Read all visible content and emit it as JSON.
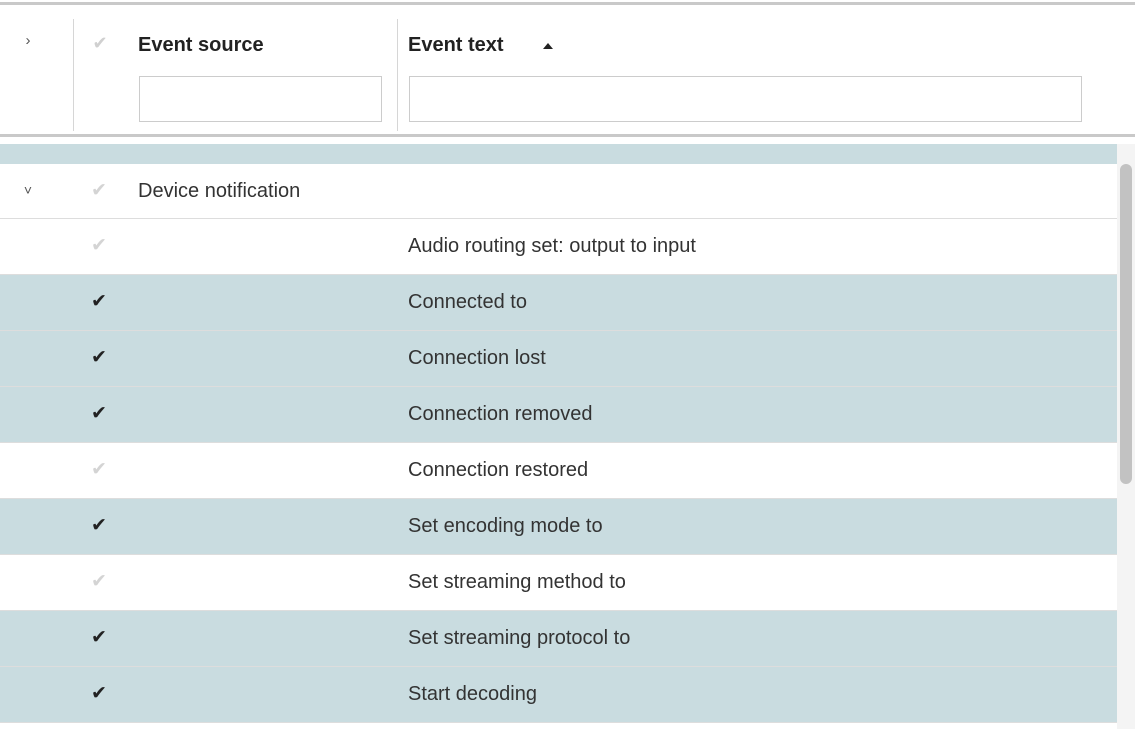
{
  "header": {
    "expand_all_icon": "chevron-right-icon",
    "expand_all_glyph": "›",
    "select_all_glyph": "✔",
    "columns": [
      {
        "label": "Event source",
        "filter_value": ""
      },
      {
        "label": "Event text",
        "filter_value": "",
        "sort": "ascending"
      }
    ]
  },
  "group": {
    "label": "Device notification",
    "toggle_glyph": "˅",
    "check_glyph": "✔",
    "selected": false
  },
  "rows": [
    {
      "text": "Audio routing set: output to input",
      "selected": false,
      "check_glyph": "✔"
    },
    {
      "text": "Connected to",
      "selected": true,
      "check_glyph": "✔"
    },
    {
      "text": "Connection lost",
      "selected": true,
      "check_glyph": "✔"
    },
    {
      "text": "Connection removed",
      "selected": true,
      "check_glyph": "✔"
    },
    {
      "text": "Connection restored",
      "selected": false,
      "check_glyph": "✔"
    },
    {
      "text": "Set encoding mode to",
      "selected": true,
      "check_glyph": "✔"
    },
    {
      "text": "Set streaming method to",
      "selected": false,
      "check_glyph": "✔"
    },
    {
      "text": "Set streaming protocol to",
      "selected": true,
      "check_glyph": "✔"
    },
    {
      "text": "Start decoding",
      "selected": true,
      "check_glyph": "✔"
    }
  ],
  "colors": {
    "selected_row": "#c9dce0",
    "unselected_row": "#ffffff",
    "border": "#c9c9c9",
    "check_on": "#222222",
    "check_off": "#d4d4d4"
  }
}
